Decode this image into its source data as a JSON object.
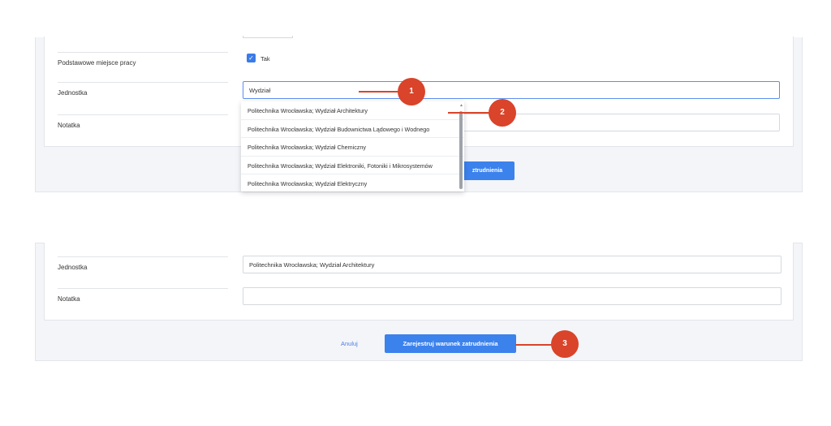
{
  "top": {
    "primary_workplace_label": "Podstawowe miejsce pracy",
    "primary_workplace_value": "Tak",
    "unit_label": "Jednostka",
    "unit_input_value": "Wydział",
    "note_label": "Notatka",
    "dropdown_items": [
      "Politechnika Wrocławska; Wydział Architektury",
      "Politechnika Wrocławska; Wydział Budownictwa Lądowego i Wodnego",
      "Politechnika Wrocławska; Wydział Chemiczny",
      "Politechnika Wrocławska; Wydział Elektroniki, Fotoniki i Mikrosystemów",
      "Politechnika Wrocławska; Wydział Elektryczny"
    ],
    "hidden_button_label": "ztrudnienia"
  },
  "bottom": {
    "unit_label": "Jednostka",
    "unit_value": "Politechnika Wrocławska; Wydział Architektury",
    "note_label": "Notatka",
    "cancel_label": "Anuluj",
    "submit_label": "Zarejestruj warunek zatrudnienia"
  },
  "callouts": [
    "1",
    "2",
    "3"
  ],
  "colors": {
    "accent": "#3c82ed",
    "callout": "#d9442a",
    "focus": "#5b8ef0"
  }
}
